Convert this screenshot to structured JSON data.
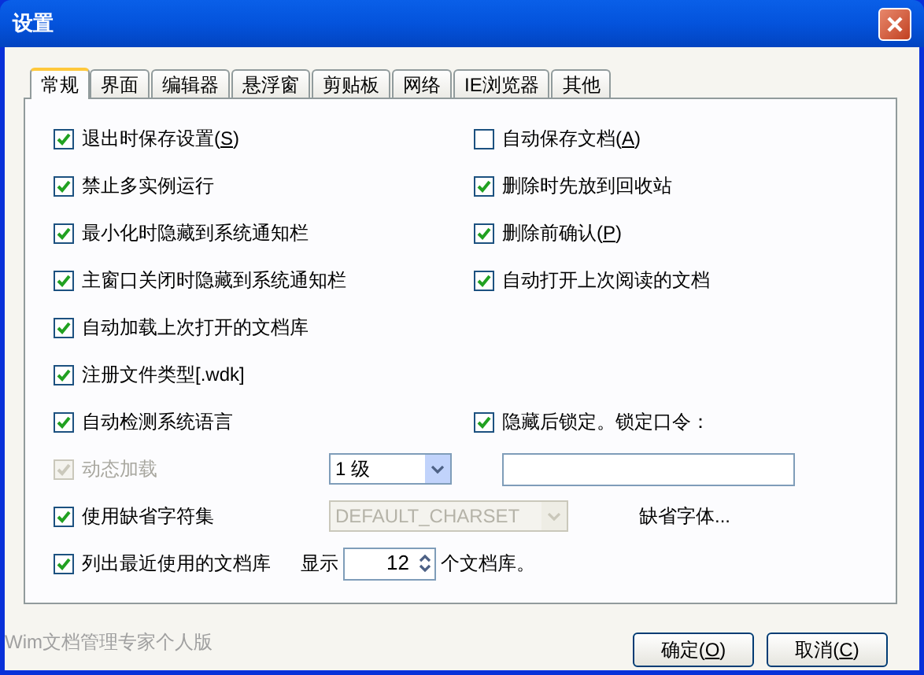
{
  "window": {
    "title": "设置"
  },
  "tabs": [
    {
      "label": "常规",
      "selected": true
    },
    {
      "label": "界面",
      "selected": false
    },
    {
      "label": "编辑器",
      "selected": false
    },
    {
      "label": "悬浮窗",
      "selected": false
    },
    {
      "label": "剪贴板",
      "selected": false
    },
    {
      "label": "网络",
      "selected": false
    },
    {
      "label": "IE浏览器",
      "selected": false
    },
    {
      "label": "其他",
      "selected": false
    }
  ],
  "rows": [
    {
      "left": {
        "label": "退出时保存设置(",
        "mnemonic": "S",
        "label_end": ")",
        "checked": true,
        "disabled": false
      },
      "right": {
        "label": "自动保存文档(",
        "mnemonic": "A",
        "label_end": ")",
        "checked": false,
        "disabled": false
      }
    },
    {
      "left": {
        "label": "禁止多实例运行",
        "checked": true,
        "disabled": false
      },
      "right": {
        "label": "删除时先放到回收站",
        "checked": true,
        "disabled": false
      }
    },
    {
      "left": {
        "label": "最小化时隐藏到系统通知栏",
        "checked": true,
        "disabled": false
      },
      "right": {
        "label": "删除前确认(",
        "mnemonic": "P",
        "label_end": ")",
        "checked": true,
        "disabled": false
      }
    },
    {
      "left": {
        "label": "主窗口关闭时隐藏到系统通知栏",
        "checked": true,
        "disabled": false
      },
      "right": {
        "label": "自动打开上次阅读的文档",
        "checked": true,
        "disabled": false
      }
    },
    {
      "left": {
        "label": "自动加载上次打开的文档库",
        "checked": true,
        "disabled": false
      }
    },
    {
      "left": {
        "label": "注册文件类型[.wdk]",
        "checked": true,
        "disabled": false
      }
    },
    {
      "left": {
        "label": "自动检测系统语言",
        "checked": true,
        "disabled": false
      },
      "right": {
        "label": "隐藏后锁定。锁定口令：",
        "checked": true,
        "disabled": false
      }
    },
    {
      "left": {
        "label": "动态加载",
        "checked": true,
        "disabled": true
      },
      "extras": [
        {
          "kind": "select",
          "value": "1 级",
          "disabled": false
        },
        {
          "kind": "field"
        }
      ]
    },
    {
      "left": {
        "label": "使用缺省字符集",
        "checked": true,
        "disabled": false
      },
      "extras": [
        {
          "kind": "select",
          "value": "DEFAULT_CHARSET",
          "disabled": true
        },
        {
          "kind": "link",
          "label": "缺省字体..."
        }
      ]
    },
    {
      "left": {
        "label": "列出最近使用的文档库",
        "checked": true,
        "disabled": false
      },
      "extras": [
        {
          "kind": "text",
          "label": "显示"
        },
        {
          "kind": "spinner",
          "value": "12"
        },
        {
          "kind": "text",
          "label": "个文档库。"
        }
      ]
    }
  ],
  "footer": "Wim文档管理专家个人版",
  "buttons": [
    {
      "label": "确定(",
      "mnemonic": "O",
      "label_end": ")"
    },
    {
      "label": "取消(",
      "mnemonic": "C",
      "label_end": ")"
    }
  ]
}
